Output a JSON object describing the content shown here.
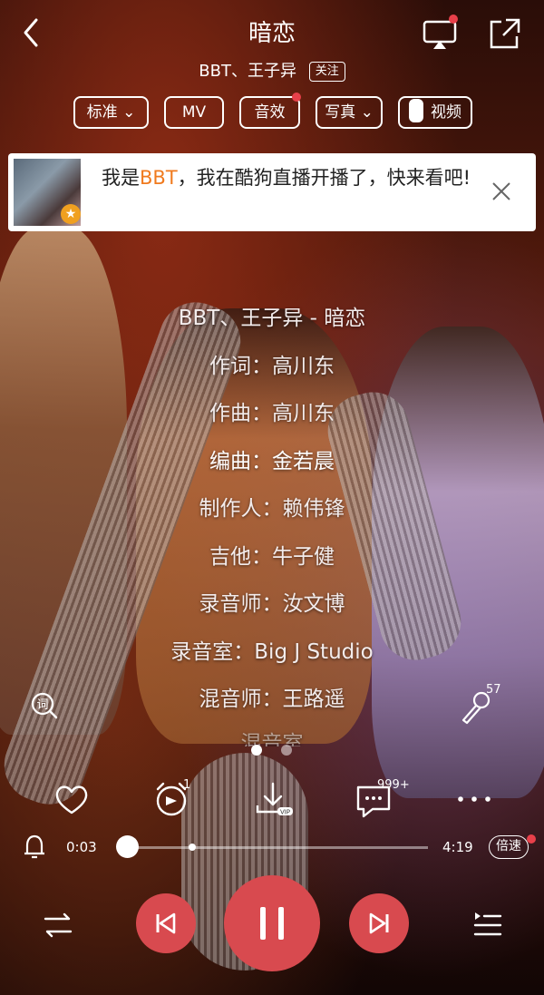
{
  "header": {
    "title": "暗恋",
    "artists": "BBT、王子异",
    "follow_label": "关注",
    "back_icon": "back-chevron-icon",
    "cast_icon": "cast-screen-icon",
    "share_icon": "share-external-icon"
  },
  "mode_pills": {
    "quality": "标准",
    "mv": "MV",
    "sound_effect": "音效",
    "photo": "写真",
    "video": "视频"
  },
  "banner": {
    "text_prefix": "我是",
    "highlight": "BBT",
    "text_suffix": "，我在酷狗直播开播了，快来看吧!"
  },
  "lyrics": [
    "BBT、王子异 - 暗恋",
    "作词：高川东",
    "作曲：高川东",
    "编曲：金若晨",
    "制作人：赖伟锋",
    "吉他：牛子健",
    "录音师：汝文博",
    "录音室：Big J Studio",
    "混音师：王路遥",
    "混音室"
  ],
  "side": {
    "lyric_icon_label": "词",
    "mic_count": "57"
  },
  "actions": {
    "comments_count": "999+",
    "playlist_badge": "1",
    "download_badge": "VIP"
  },
  "player": {
    "current_time": "0:03",
    "total_time": "4:19",
    "speed_label": "倍速",
    "progress_fraction": 0.012
  },
  "colors": {
    "accent_red": "#d84a4f",
    "highlight_orange": "#f07a1e",
    "dot_red": "#e8404a"
  }
}
